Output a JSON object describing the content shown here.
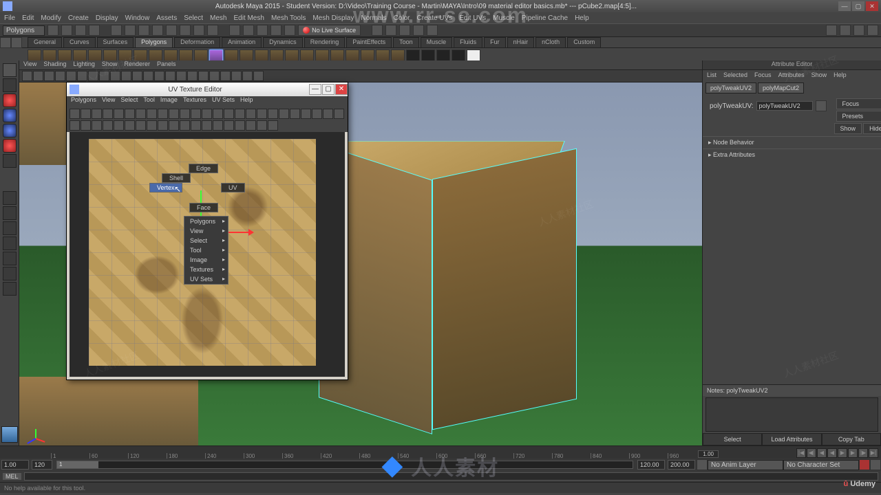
{
  "window": {
    "title": "Autodesk Maya 2015 - Student Version: D:\\Video\\Training Course - Martin\\MAYA\\Intro\\09 material editor basics.mb*  ---  pCube2.map[4:5]...",
    "min": "—",
    "max": "▢",
    "close": "✕"
  },
  "menubar": [
    "File",
    "Edit",
    "Modify",
    "Create",
    "Display",
    "Window",
    "Assets",
    "Select",
    "Mesh",
    "Edit Mesh",
    "Mesh Tools",
    "Mesh Display",
    "Normals",
    "Color",
    "Create UVs",
    "Edit UVs",
    "Muscle",
    "Pipeline Cache",
    "Help"
  ],
  "module_dropdown": "Polygons",
  "status_line": {
    "no_live_surface": "No Live Surface"
  },
  "shelf_tabs": [
    "General",
    "Curves",
    "Surfaces",
    "Polygons",
    "Deformation",
    "Animation",
    "Dynamics",
    "Rendering",
    "PaintEffects",
    "Toon",
    "Muscle",
    "Fluids",
    "Fur",
    "nHair",
    "nCloth",
    "Custom"
  ],
  "shelf_active": "Polygons",
  "viewport_menu": [
    "View",
    "Shading",
    "Lighting",
    "Show",
    "Renderer",
    "Panels"
  ],
  "attribute_editor": {
    "title": "Attribute Editor",
    "tabs": [
      "List",
      "Selected",
      "Focus",
      "Attributes",
      "Show",
      "Help"
    ],
    "nodes": [
      "polyTweakUV2",
      "polyMapCut2"
    ],
    "field_label": "polyTweakUV:",
    "field_value": "polyTweakUV2",
    "buttons": {
      "focus": "Focus",
      "presets": "Presets",
      "show": "Show",
      "hide": "Hide"
    },
    "sections": [
      "Node Behavior",
      "Extra Attributes"
    ],
    "notes_label": "Notes: polyTweakUV2",
    "bottom": [
      "Select",
      "Load Attributes",
      "Copy Tab"
    ]
  },
  "uv_editor": {
    "title": "UV Texture Editor",
    "menu": [
      "Polygons",
      "View",
      "Select",
      "Tool",
      "Image",
      "Textures",
      "UV Sets",
      "Help"
    ],
    "marking_menu": {
      "north": "Shell",
      "west": "Vertex",
      "east": "UV",
      "south": "Face",
      "ne": "Edge"
    },
    "context_menu": [
      "Polygons",
      "View",
      "Select",
      "Tool",
      "Image",
      "Textures",
      "UV Sets"
    ]
  },
  "timeline": {
    "ticks": [
      1,
      60,
      120,
      180,
      240,
      300,
      360,
      420,
      480,
      540,
      600,
      660,
      720,
      780,
      840,
      900,
      960
    ],
    "current": "1.00",
    "range_start": "1.00",
    "range_end_inner": "120",
    "range_end": "120.00",
    "total_end": "200.00",
    "anim_layer": "No Anim Layer",
    "char_set": "No Character Set"
  },
  "cmdline": {
    "lang": "MEL"
  },
  "helpline": "No help available for this tool.",
  "watermark_top": "www.rr-sc.com",
  "watermark_cn": "人人素材",
  "watermark_club": "人人素材社区",
  "udemy": "Udemy"
}
